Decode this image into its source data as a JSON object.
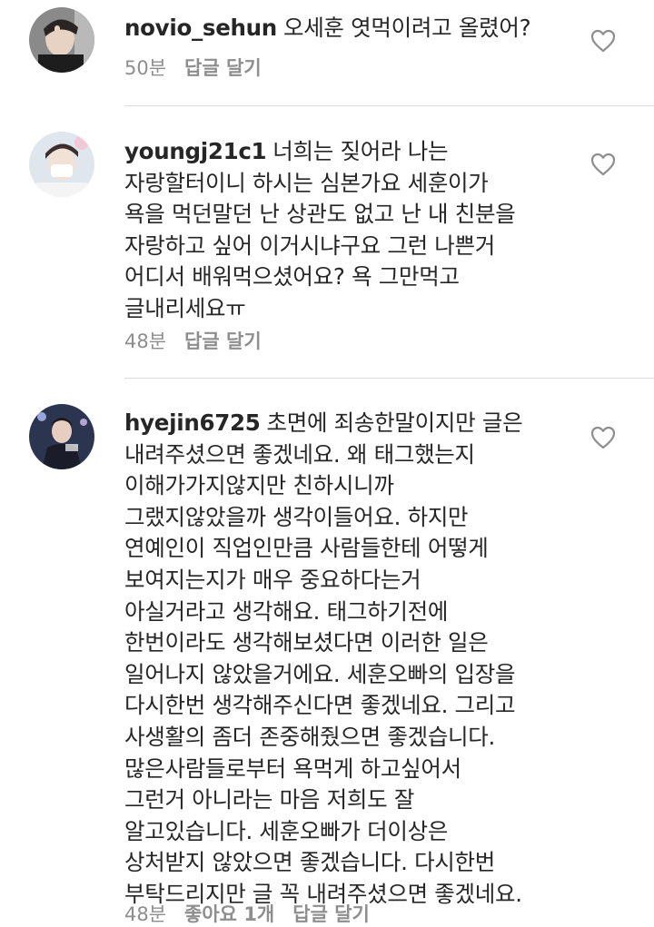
{
  "comments": [
    {
      "username": "novio_sehun",
      "text": "오세훈 엿먹이려고 올렸어?",
      "time": "50분",
      "likes": "",
      "reply": "답글 달기"
    },
    {
      "username": "youngj21c1",
      "text": "너희는 짖어라 나는\n자랑할터이니 하시는 심본가요 세훈이가\n욕을 먹던말던 난 상관도 없고 난 내 친분을\n자랑하고 싶어 이거시냐구요 그런 나쁜거\n어디서 배워먹으셨어요? 욕 그만먹고\n글내리세요ㅠ",
      "time": "48분",
      "likes": "",
      "reply": "답글 달기"
    },
    {
      "username": "hyejin6725",
      "text": "초면에 죄송한말이지만 글은\n내려주셨으면 좋겠네요. 왜 태그했는지\n이해가가지않지만 친하시니까\n그랬지않았을까 생각이들어요. 하지만\n연예인이 직업인만큼 사람들한테 어떻게\n보여지는지가 매우 중요하다는거\n아실거라고 생각해요. 태그하기전에\n한번이라도 생각해보셨다면 이러한 일은\n일어나지 않았을거에요. 세훈오빠의 입장을\n다시한번 생각해주신다면 좋겠네요. 그리고\n사생활의 좀더 존중해줬으면 좋겠습니다.\n많은사람들로부터 욕먹게 하고싶어서\n그런거 아니라는 마음 저희도 잘\n알고있습니다. 세훈오빠가 더이상은\n상처받지 않았으면 좋겠습니다. 다시한번\n부탁드리지만 글 꼭 내려주셨으면 좋겠네요.",
      "time": "48분",
      "likes": "좋아요 1개",
      "reply": "답글 달기"
    }
  ],
  "icons": {
    "like": "heart-outline-icon"
  },
  "colors": {
    "text": "#262626",
    "meta": "#8e8e8e",
    "divider": "#dbdbdb"
  }
}
